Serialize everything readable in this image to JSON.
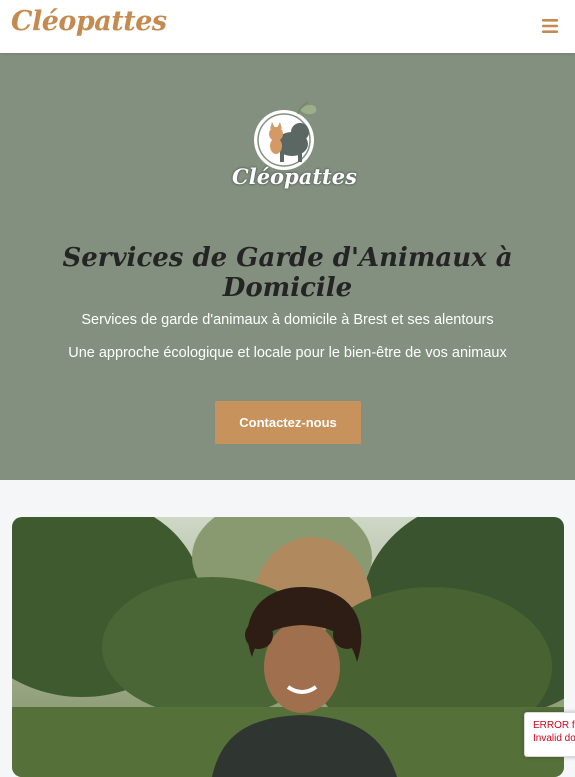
{
  "navbar": {
    "brand": "Cléopattes",
    "menu_icon": "hamburger-menu-icon",
    "accent_color": "#c48a50"
  },
  "hero": {
    "logo_icon": "cat-dog-logo-icon",
    "logo_text": "Cléopattes",
    "title": "Services de Garde d'Animaux à Domicile",
    "subtitle_1": "Services de garde d'animaux à domicile à Brest et ses alentours",
    "subtitle_2": "Une approche écologique et locale pour le bien-être de vos animaux",
    "cta_label": "Contactez-nous",
    "background_color": "#84907f",
    "button_color": "#c8925c"
  },
  "main": {
    "photo": "pet-sitter-portrait-photo"
  },
  "recaptcha": {
    "line_1": "ERROR fo",
    "line_2": "Invalid do"
  }
}
